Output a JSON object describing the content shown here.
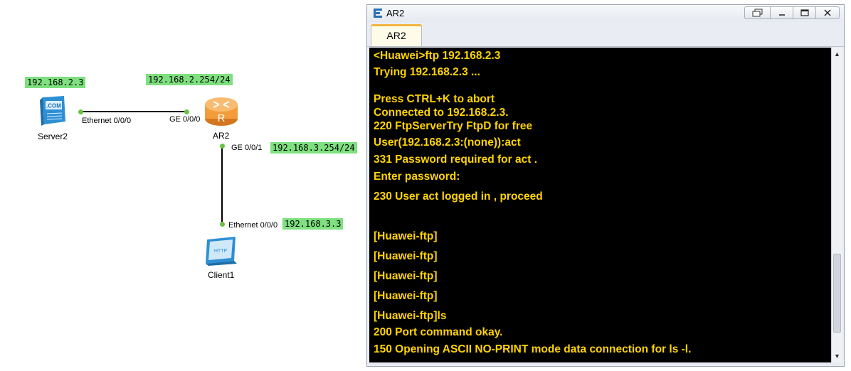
{
  "topology": {
    "devices": {
      "server": {
        "name": "Server2",
        "icon_text": ".COM",
        "ip": "192.168.2.3",
        "port": "Ethernet 0/0/0"
      },
      "router": {
        "name": "AR2",
        "icon_text": "R",
        "port_to_server": "GE 0/0/0",
        "port_to_client": "GE 0/0/1",
        "ip_server_side": "192.168.2.254/24",
        "ip_client_side": "192.168.3.254/24"
      },
      "client": {
        "name": "Client1",
        "icon_text": "HTTP",
        "ip": "192.168.3.3",
        "port": "Ethernet 0/0/0"
      }
    },
    "colors": {
      "ip_label_bg": "#7ee07e",
      "link": "#000000",
      "port_dot": "#69c242",
      "router": "#f39c3c"
    }
  },
  "window": {
    "title": "AR2",
    "icon": "ensp-app-icon",
    "controls": [
      "restore-icon",
      "minimize-icon",
      "maximize-icon",
      "close-icon"
    ],
    "tab_label": "AR2",
    "colors": {
      "console_bg": "#000000",
      "console_text": "#ffd400",
      "tab_accent": "#f2b640"
    }
  },
  "console": {
    "lines": [
      "<Huawei>ftp 192.168.2.3",
      "Trying 192.168.2.3 ...",
      "Press CTRL+K to abort",
      "Connected to 192.168.2.3.",
      "220 FtpServerTry FtpD for free",
      "User(192.168.2.3:(none)):act",
      "331 Password required for act .",
      "Enter password:",
      "230 User act logged in , proceed",
      "[Huawei-ftp]",
      "[Huawei-ftp]",
      "[Huawei-ftp]",
      "[Huawei-ftp]",
      "[Huawei-ftp]ls",
      "200 Port command okay.",
      "150 Opening ASCII NO-PRINT mode data connection for ls -l."
    ]
  }
}
